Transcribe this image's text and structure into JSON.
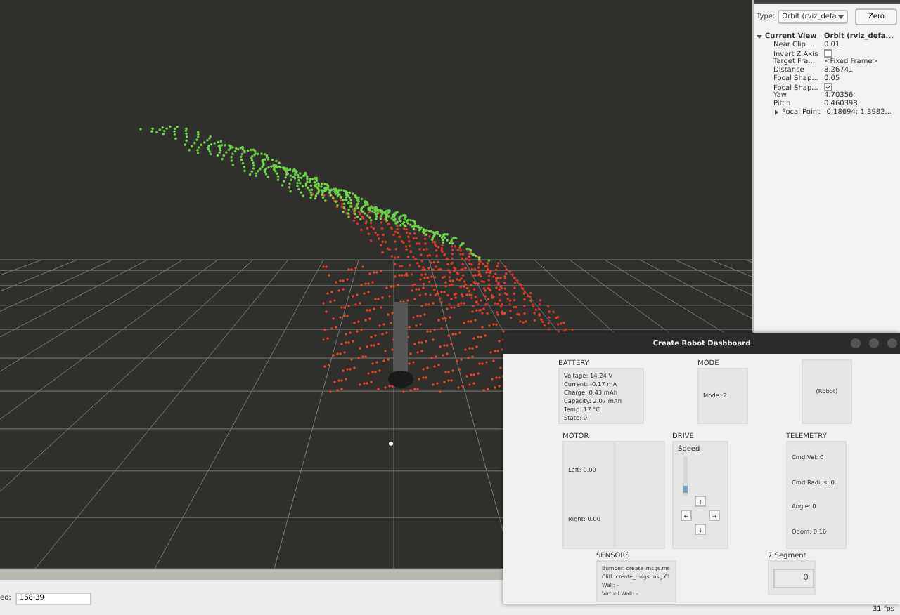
{
  "views_panel": {
    "type_label": "Type:",
    "type_value": "Orbit (rviz_defa",
    "zero_button": "Zero",
    "tree": [
      {
        "name": "Current View",
        "value": "Orbit (rviz_defa...",
        "expanded": true,
        "children": [
          {
            "kind": "text",
            "name": "Near Clip ...",
            "value": "0.01"
          },
          {
            "kind": "checkbox",
            "name": "Invert Z Axis",
            "checked": false
          },
          {
            "kind": "text",
            "name": "Target Fra...",
            "value": "<Fixed Frame>"
          },
          {
            "kind": "text",
            "name": "Distance",
            "value": "8.26741"
          },
          {
            "kind": "text",
            "name": "Focal Shap...",
            "value": "0.05"
          },
          {
            "kind": "checkbox",
            "name": "Focal Shap...",
            "checked": true
          },
          {
            "kind": "text",
            "name": "Yaw",
            "value": "4.70356"
          },
          {
            "kind": "text",
            "name": "Pitch",
            "value": "0.460398"
          },
          {
            "kind": "group",
            "name": "Focal Point",
            "value": "-0.18694; 1.3982...",
            "expanded": false
          }
        ]
      }
    ]
  },
  "bottom_bar": {
    "label": "ed:",
    "value": "168.39",
    "fps": "31 fps"
  },
  "dashboard": {
    "title": "Create Robot Dashboard",
    "battery": {
      "heading": "BATTERY",
      "lines": [
        "Voltage: 14.24 V",
        "Current: -0.17 mA",
        "Charge: 0.43 mAh",
        "Capacity: 2.07 mAh",
        "Temp: 17 °C",
        "State: 0"
      ]
    },
    "mode": {
      "heading": "MODE",
      "text": "Mode: 2"
    },
    "robot": "(Robot)",
    "motor": {
      "heading": "MOTOR",
      "left": "Left: 0.00",
      "right": "Right: 0.00"
    },
    "drive": {
      "heading": "DRIVE",
      "speed_label": "Speed",
      "speed": {
        "level": 0.1
      },
      "up": "↑",
      "left": "←",
      "right": "→",
      "down": "↓"
    },
    "telemetry": {
      "heading": "TELEMETRY",
      "lines": [
        "Cmd Vel: 0",
        "Cmd Radius: 0",
        "Angle: 0",
        "Odom: 0.16"
      ]
    },
    "sensors": {
      "heading": "SENSORS",
      "lines": [
        "Bumper: create_msgs.ms",
        "Cliff: create_msgs.msg.Cl",
        "Wall: –",
        "Virtual Wall: –"
      ]
    },
    "seven_segment": {
      "heading": "7 Segment",
      "display": "0"
    }
  }
}
